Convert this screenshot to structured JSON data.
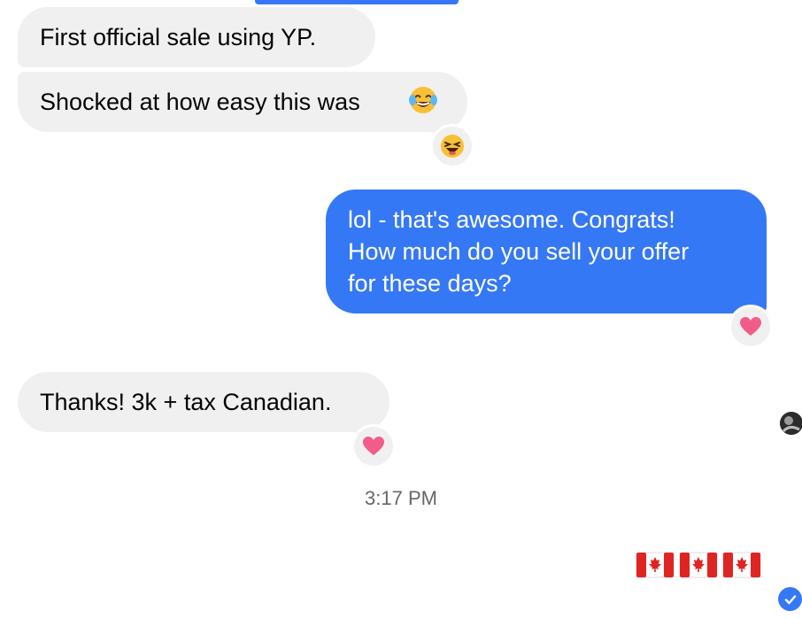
{
  "messages": [
    {
      "text": "First official sale using YP."
    },
    {
      "text": "Shocked at how easy this was",
      "emoji": "face-with-tears-of-joy",
      "reaction": "laughing"
    },
    {
      "lines": [
        "lol - that's awesome. Congrats!",
        "How much do you sell your offer",
        "for these days?"
      ],
      "reaction": "heart"
    },
    {
      "text": "Thanks! 3k + tax Canadian.",
      "reaction": "heart"
    }
  ],
  "timestamp": "3:17 PM",
  "flags": [
    "canada-flag",
    "canada-flag",
    "canada-flag"
  ],
  "colors": {
    "outgoing_bubble": "#3578f6",
    "incoming_bubble": "#f0f0f0",
    "heart": "#f25c8a",
    "laugh_emoji": "#f8c036",
    "flag_red": "#e02424"
  }
}
